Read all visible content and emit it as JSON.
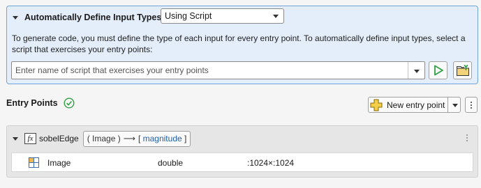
{
  "define_input_types": {
    "title": "Automatically Define Input Types",
    "mode_selected": "Using Script",
    "description": "To generate code, you must define the type of each input for every entry point. To automatically define input types, select a script that exercises your entry points:",
    "script_input_placeholder": "Enter name of script that exercises your entry points",
    "script_input_value": ""
  },
  "entry_points": {
    "title": "Entry Points",
    "new_entry_point_label": "New entry point",
    "items": [
      {
        "function_name": "sobelEdge",
        "signature": {
          "inputs_text": "( Image )",
          "arrow": "⟶",
          "open_bracket": "[",
          "outputs_text": "magnitude",
          "close_bracket": "]"
        },
        "inputs": [
          {
            "name": "Image",
            "type": "double",
            "size": ":1024×:1024"
          }
        ]
      }
    ]
  },
  "colors": {
    "panel_bg": "#e3eefa",
    "panel_border": "#6fa4d8",
    "run_green": "#2ea043",
    "output_blue": "#1f5fa8",
    "check_green": "#2ea043"
  }
}
